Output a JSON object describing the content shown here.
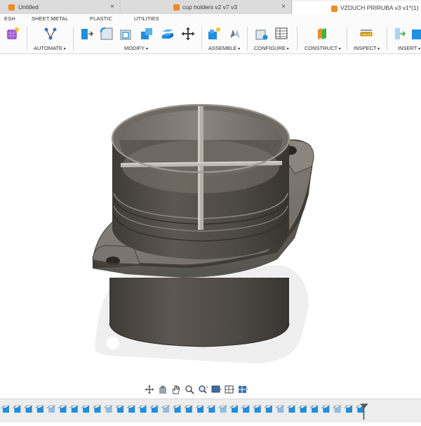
{
  "tabs": [
    {
      "label": "Untitled",
      "active": false
    },
    {
      "label": "cup holders v2 v7 v3",
      "active": false
    },
    {
      "label": "VZDUCH PRIRUBA v3 v1*(1)",
      "active": true
    }
  ],
  "tab_close_glyph": "×",
  "workspace_tabs": [
    "ESH",
    "SHEET METAL",
    "PLASTIC",
    "UTILITIES"
  ],
  "toolbar_groups": [
    {
      "label": "AUTOMATE"
    },
    {
      "label": "MODIFY"
    },
    {
      "label": "ASSEMBLE"
    },
    {
      "label": "CONFIGURE"
    },
    {
      "label": "CONSTRUCT"
    },
    {
      "label": "INSPECT"
    },
    {
      "label": "INSERT"
    }
  ],
  "colors": {
    "accent_blue": "#1f8fe0",
    "brand_orange": "#f18a25",
    "model_dark": "#555049",
    "model_mid": "#6f6a63",
    "model_light": "#8e8a83"
  },
  "nav_icons": [
    "orbit-icon",
    "look-at-icon",
    "pan-icon",
    "zoom-icon",
    "zoom-window-icon",
    "display-settings-icon",
    "grid-settings-icon",
    "viewports-icon"
  ],
  "timeline_count": 32
}
